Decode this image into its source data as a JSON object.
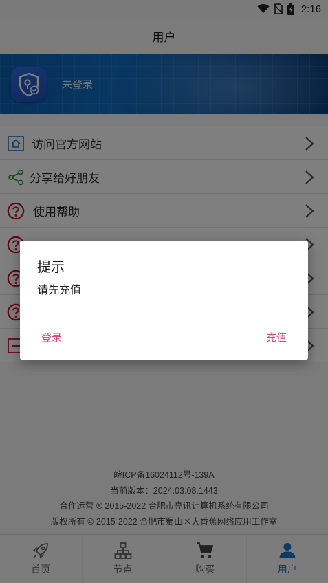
{
  "status_bar": {
    "time": "2:16"
  },
  "header": {
    "title": "用户"
  },
  "profile": {
    "status": "未登录"
  },
  "menu": {
    "items": [
      {
        "label": "访问官方网站",
        "icon": "home-icon",
        "color": "#1a73c8"
      },
      {
        "label": "分享给好朋友",
        "icon": "share-icon",
        "color": "#2e9b3a"
      },
      {
        "label": "使用帮助",
        "icon": "help-icon",
        "color": "#c8102e"
      },
      {
        "label": "",
        "icon": "help-icon",
        "color": "#c8102e"
      },
      {
        "label": "",
        "icon": "help-icon",
        "color": "#c8102e"
      },
      {
        "label": "",
        "icon": "help-icon",
        "color": "#c8102e"
      },
      {
        "label": "",
        "icon": "logout-icon",
        "color": "#c8102e"
      }
    ]
  },
  "footer": {
    "icp": "皖ICP备16024112号-139A",
    "version": "当前版本：2024.03.08.1443",
    "operator": "合作运营 ® 2015-2022 合肥市亮讯计算机系统有限公司",
    "copyright": "版权所有 © 2015-2022 合肥市蜀山区大香蕉网络应用工作室"
  },
  "tabs": [
    {
      "label": "首页",
      "icon": "rocket-icon",
      "active": false
    },
    {
      "label": "节点",
      "icon": "network-icon",
      "active": false
    },
    {
      "label": "购买",
      "icon": "cart-icon",
      "active": false
    },
    {
      "label": "用户",
      "icon": "user-icon",
      "active": true
    }
  ],
  "dialog": {
    "title": "提示",
    "message": "请先充值",
    "login_button": "登录",
    "recharge_button": "充值"
  },
  "colors": {
    "accent": "#1a73c8",
    "dialog_button": "#e0457b",
    "help_red": "#c8102e",
    "share_green": "#2e9b3a"
  }
}
